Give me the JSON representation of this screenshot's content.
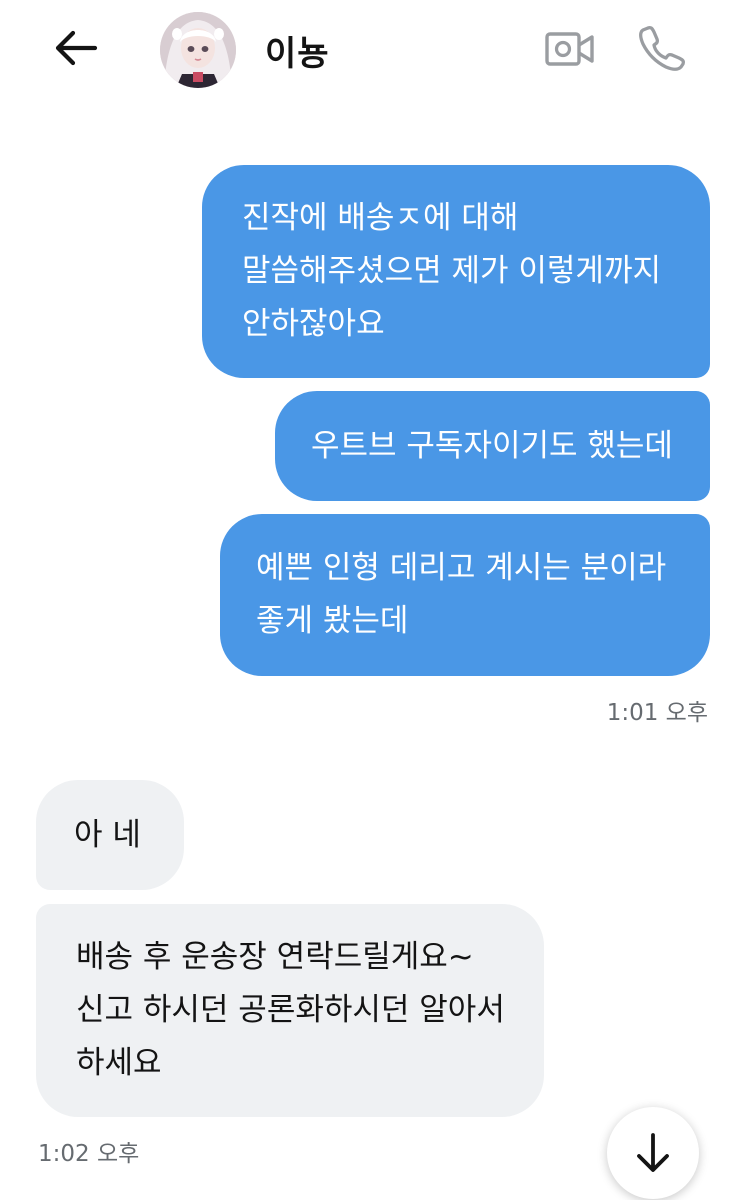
{
  "header": {
    "contact_name": "이뇽",
    "back_icon": "arrow-left-icon",
    "video_icon": "video-camera-icon",
    "call_icon": "phone-icon"
  },
  "messages": [
    {
      "direction": "outgoing",
      "lines": [
        "진작에 배송ㅈ에 대해",
        "말씀해주셨으면 제가 이렇게까지",
        "안하잖아요"
      ]
    },
    {
      "direction": "outgoing",
      "lines": [
        "우트브 구독자이기도 했는데"
      ]
    },
    {
      "direction": "outgoing",
      "lines": [
        "예쁜 인형 데리고 계시는 분이라",
        "좋게 봤는데"
      ]
    },
    {
      "direction": "incoming",
      "lines": [
        "아 네"
      ]
    },
    {
      "direction": "incoming",
      "lines": [
        "배송 후 운송장 연락드릴게요~",
        "신고 하시던 공론화하시던 알아서",
        "하세요"
      ]
    }
  ],
  "timestamps": {
    "outgoing_group": "1:01 오후",
    "incoming_group": "1:02 오후"
  },
  "scroll_button_icon": "arrow-down-icon",
  "colors": {
    "outgoing_bubble": "#4a97e6",
    "incoming_bubble": "#eff1f3",
    "header_icon_gray": "#9a9da1"
  }
}
